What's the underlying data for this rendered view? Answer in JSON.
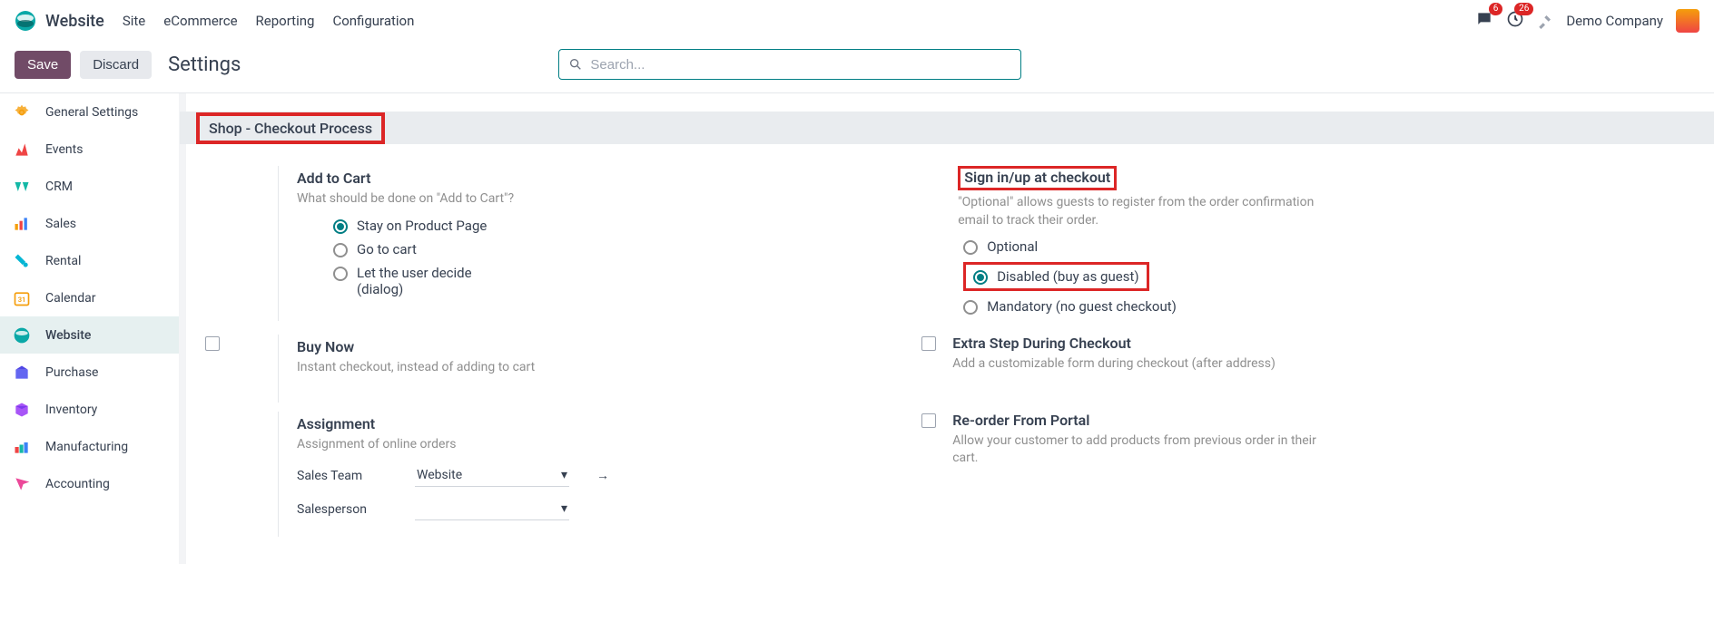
{
  "nav": {
    "app": "Website",
    "menu": [
      "Site",
      "eCommerce",
      "Reporting",
      "Configuration"
    ],
    "chat_badge": "6",
    "clock_badge": "26",
    "company": "Demo Company"
  },
  "action": {
    "save": "Save",
    "discard": "Discard",
    "title": "Settings",
    "search_placeholder": "Search..."
  },
  "sidebar": [
    {
      "label": "General Settings"
    },
    {
      "label": "Events"
    },
    {
      "label": "CRM"
    },
    {
      "label": "Sales"
    },
    {
      "label": "Rental"
    },
    {
      "label": "Calendar"
    },
    {
      "label": "Website",
      "active": true
    },
    {
      "label": "Purchase"
    },
    {
      "label": "Inventory"
    },
    {
      "label": "Manufacturing"
    },
    {
      "label": "Accounting"
    }
  ],
  "section": {
    "title": "Shop - Checkout Process"
  },
  "addToCart": {
    "title": "Add to Cart",
    "sub": "What should be done on \"Add to Cart\"?",
    "opts": [
      "Stay on Product Page",
      "Go to cart",
      "Let the user decide (dialog)"
    ]
  },
  "signin": {
    "title": "Sign in/up at checkout",
    "sub": "\"Optional\" allows guests to register from the order confirmation email to track their order.",
    "opts": [
      "Optional",
      "Disabled (buy as guest)",
      "Mandatory (no guest checkout)"
    ]
  },
  "buyNow": {
    "title": "Buy Now",
    "sub": "Instant checkout, instead of adding to cart"
  },
  "extraStep": {
    "title": "Extra Step During Checkout",
    "sub": "Add a customizable form during checkout (after address)"
  },
  "assignment": {
    "title": "Assignment",
    "sub": "Assignment of online orders",
    "salesTeamLabel": "Sales Team",
    "salesTeamValue": "Website",
    "salespersonLabel": "Salesperson"
  },
  "reorder": {
    "title": "Re-order From Portal",
    "sub": "Allow your customer to add products from previous order in their cart."
  }
}
